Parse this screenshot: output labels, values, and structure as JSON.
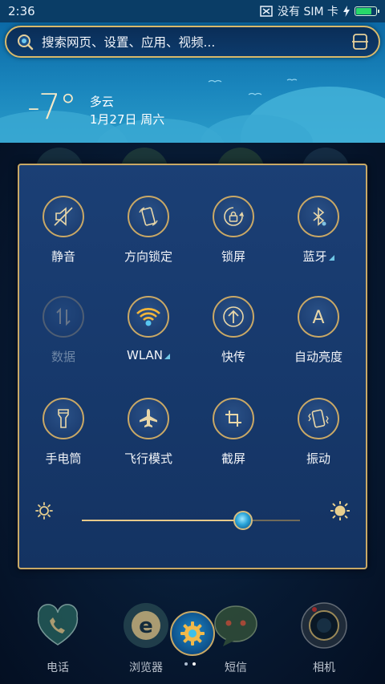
{
  "status_bar": {
    "time": "2:36",
    "sim_text": "没有 SIM 卡",
    "battery_level": 0.85,
    "icons": [
      "no-sim-icon",
      "charging-icon",
      "battery-icon"
    ]
  },
  "search": {
    "placeholder": "搜索网页、设置、应用、视频..."
  },
  "weather": {
    "temperature": "-7°",
    "condition": "多云",
    "date": "1月27日 周六"
  },
  "toggles": [
    {
      "label": "静音",
      "icon": "mute-icon",
      "enabled": true
    },
    {
      "label": "方向锁定",
      "icon": "rotation-lock-icon",
      "enabled": true
    },
    {
      "label": "锁屏",
      "icon": "lock-screen-icon",
      "enabled": true
    },
    {
      "label": "蓝牙",
      "icon": "bluetooth-icon",
      "enabled": true
    },
    {
      "label": "数据",
      "icon": "mobile-data-icon",
      "enabled": false
    },
    {
      "label": "WLAN",
      "icon": "wifi-icon",
      "enabled": true
    },
    {
      "label": "快传",
      "icon": "quick-transfer-icon",
      "enabled": true
    },
    {
      "label": "自动亮度",
      "icon": "auto-brightness-icon",
      "enabled": true
    },
    {
      "label": "手电筒",
      "icon": "flashlight-icon",
      "enabled": true
    },
    {
      "label": "飞行模式",
      "icon": "airplane-icon",
      "enabled": true
    },
    {
      "label": "截屏",
      "icon": "screenshot-icon",
      "enabled": true
    },
    {
      "label": "振动",
      "icon": "vibrate-icon",
      "enabled": true
    }
  ],
  "brightness": {
    "level": 0.74
  },
  "dock": {
    "apps": [
      {
        "label": "电话",
        "icon": "phone-icon"
      },
      {
        "label": "浏览器",
        "icon": "browser-icon"
      },
      {
        "label": "短信",
        "icon": "sms-icon"
      },
      {
        "label": "相机",
        "icon": "camera-icon"
      }
    ],
    "center_icon": "settings-gear-icon"
  },
  "colors": {
    "gold_accent": "#c9a966",
    "panel_blue": "#17396c",
    "sky_blue": "#1a86bd"
  }
}
